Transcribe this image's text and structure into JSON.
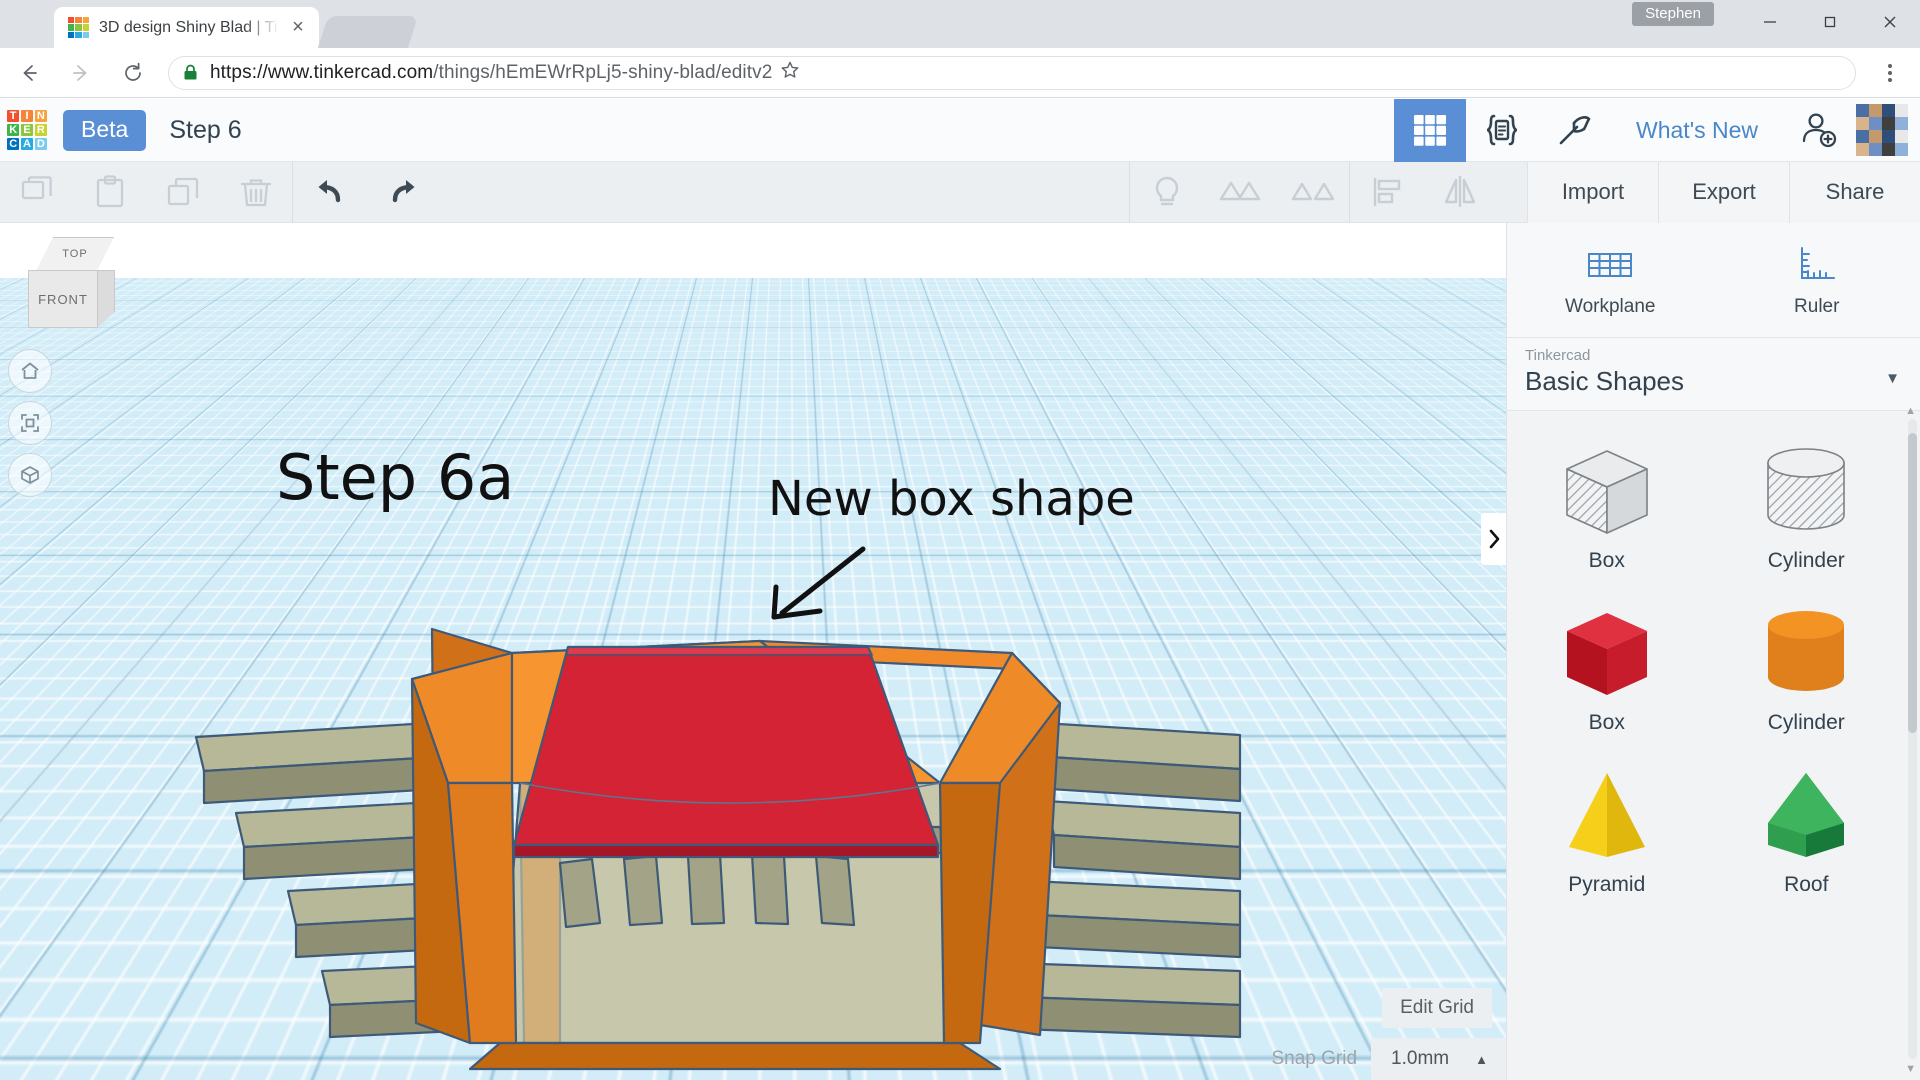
{
  "browser": {
    "tab": {
      "title": "3D design Shiny Blad | Ti",
      "favicon_name": "tinkercad-favicon",
      "close_label": "×"
    },
    "nav": {
      "back": "←",
      "forward": "→",
      "reload": "⟳"
    },
    "omnibox": {
      "url_scheme_host": "https://www.tinkercad.com",
      "url_path": "/things/hEmEWrRpLj5-shiny-blad/editv2",
      "lock_name": "secure-lock-icon",
      "star_name": "bookmark-star-icon"
    },
    "window": {
      "user_label": "Stephen",
      "minimize": "─",
      "maximize": "❐",
      "close": "✕"
    }
  },
  "app_header": {
    "logo_letters": [
      "T",
      "I",
      "N",
      "K",
      "E",
      "R",
      "C",
      "A",
      "D"
    ],
    "logo_colors": [
      "#f2502c",
      "#f5833a",
      "#f9a13a",
      "#3fb549",
      "#8cc63e",
      "#c6d42f",
      "#0071bc",
      "#29abe2",
      "#7accee"
    ],
    "beta_badge": "Beta",
    "project_title": "Step 6",
    "modes": [
      {
        "name": "design-mode",
        "icon": "grid-icon",
        "active": true
      },
      {
        "name": "codeblocks-mode",
        "icon": "code-brackets-icon",
        "active": false
      },
      {
        "name": "tinker-mode",
        "icon": "pickaxe-icon",
        "active": false
      }
    ],
    "whats_new": "What's New",
    "add_user_icon": "add-person-icon",
    "avatar_icon": "user-avatar"
  },
  "toolbar": {
    "edit_tools": [
      {
        "name": "copy-button",
        "icon": "copy-icon",
        "enabled": false
      },
      {
        "name": "paste-button",
        "icon": "paste-icon",
        "enabled": false
      },
      {
        "name": "duplicate-button",
        "icon": "duplicate-icon",
        "enabled": false
      },
      {
        "name": "delete-button",
        "icon": "trash-icon",
        "enabled": false
      }
    ],
    "history_tools": [
      {
        "name": "undo-button",
        "icon": "undo-arrow-icon",
        "enabled": true
      },
      {
        "name": "redo-button",
        "icon": "redo-arrow-icon",
        "enabled": true
      }
    ],
    "view_tools": [
      {
        "name": "light-button",
        "icon": "lightbulb-icon",
        "enabled": false
      },
      {
        "name": "group-button",
        "icon": "group-shapes-icon",
        "enabled": false
      },
      {
        "name": "ungroup-button",
        "icon": "ungroup-shapes-icon",
        "enabled": false
      }
    ],
    "align_tools": [
      {
        "name": "align-button",
        "icon": "align-icon",
        "enabled": false
      },
      {
        "name": "mirror-button",
        "icon": "mirror-icon",
        "enabled": false
      }
    ],
    "actions": [
      {
        "name": "import-button",
        "label": "Import"
      },
      {
        "name": "export-button",
        "label": "Export"
      },
      {
        "name": "share-button",
        "label": "Share"
      }
    ]
  },
  "viewport": {
    "viewcube": {
      "top_label": "TOP",
      "front_label": "FRONT"
    },
    "nav_tools": [
      {
        "name": "home-view-button",
        "icon": "home-icon"
      },
      {
        "name": "fit-view-button",
        "icon": "fit-frame-icon"
      },
      {
        "name": "ortho-perspective-button",
        "icon": "cube-view-icon"
      }
    ],
    "annotations": [
      {
        "name": "annotation-step-label",
        "text": "Step 6a"
      },
      {
        "name": "annotation-new-box-label",
        "text": "New box shape"
      }
    ],
    "grid_controls": {
      "edit_grid_label": "Edit Grid",
      "snap_grid_label": "Snap Grid",
      "snap_grid_value": "1.0mm",
      "snap_caret": "▲"
    },
    "collapse_tab_icon": "chevron-right-icon"
  },
  "panel": {
    "tools": [
      {
        "name": "workplane-tool",
        "label": "Workplane",
        "icon": "workplane-icon"
      },
      {
        "name": "ruler-tool",
        "label": "Ruler",
        "icon": "ruler-icon"
      }
    ],
    "library": {
      "owner": "Tinkercad",
      "collection": "Basic Shapes",
      "caret": "▼"
    },
    "shapes": [
      {
        "name": "shape-box-hole",
        "label": "Box",
        "art": "box-hole"
      },
      {
        "name": "shape-cylinder-hole",
        "label": "Cylinder",
        "art": "cylinder-hole"
      },
      {
        "name": "shape-box-red",
        "label": "Box",
        "art": "box-red"
      },
      {
        "name": "shape-cylinder-orange",
        "label": "Cylinder",
        "art": "cylinder-orange"
      },
      {
        "name": "shape-pyramid",
        "label": "Pyramid",
        "art": "pyramid-yellow"
      },
      {
        "name": "shape-roof",
        "label": "Roof",
        "art": "roof-green"
      }
    ],
    "scroll": {
      "up": "▲",
      "down": "▼"
    }
  },
  "colors": {
    "accent_blue": "#5a8fd6",
    "link_blue": "#4a87c8",
    "model_orange": "#e87d1e",
    "model_red": "#d0202f",
    "model_tan": "#b0b08a",
    "workplane_blue": "#d3edf8"
  }
}
